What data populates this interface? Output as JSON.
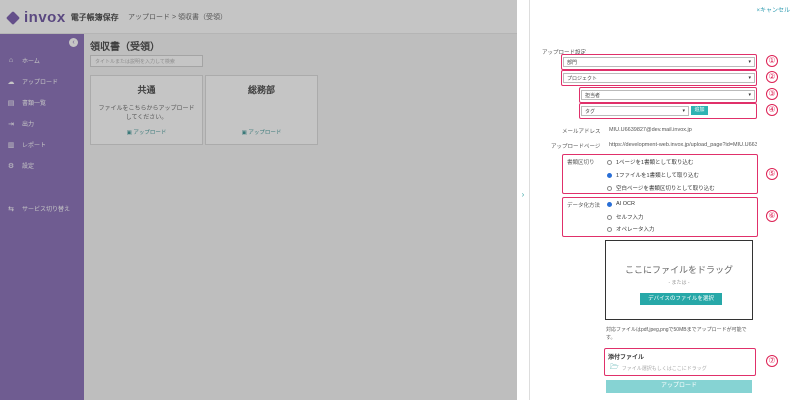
{
  "app": {
    "logo_word": "invox",
    "logo_sub": "電子帳簿保存",
    "breadcrumb": "アップロード > 領収書（受領）"
  },
  "sidebar": {
    "items": [
      {
        "icon": "⌂",
        "label": "ホーム"
      },
      {
        "icon": "☁",
        "label": "アップロード"
      },
      {
        "icon": "▤",
        "label": "書類一覧"
      },
      {
        "icon": "⇥",
        "label": "出力"
      },
      {
        "icon": "▥",
        "label": "レポート"
      },
      {
        "icon": "⚙",
        "label": "設定"
      },
      {
        "icon": "⇆",
        "label": "サービス切り替え"
      }
    ]
  },
  "main": {
    "title": "領収書（受領）",
    "search_placeholder": "タイトルまたは説明を入力して検索",
    "cards": [
      {
        "title": "共通",
        "desc": "ファイルをこちらからアップロードしてください。",
        "upload": "アップロード"
      },
      {
        "title": "総務部",
        "desc": "",
        "upload": "アップロード"
      }
    ]
  },
  "panel": {
    "cancel": "×キャンセル",
    "upload_dest_label": "アップロード設定",
    "department": "部門",
    "project": "プロジェクト",
    "assignee": "担当者",
    "tag": "タグ",
    "add": "追加",
    "email_label": "メールアドレス",
    "email_value": "MIU.U6639827@dev.mail.invox.jp",
    "page_label": "アップロードページ",
    "page_value": "https://development-web.invox.jp/upload_page?id=MIU.U663",
    "split_label": "書類区切り",
    "split_options": [
      "1ページを1書類として取り込む",
      "1ファイルを1書類として取り込む",
      "空白ページを書類区切りとして取り込む"
    ],
    "split_selected": 1,
    "data_label": "データ化方法",
    "data_options": [
      "AI OCR",
      "セルフ入力",
      "オペレータ入力"
    ],
    "data_selected": 0,
    "drop_title": "ここにファイルをドラッグ",
    "drop_or": "- または -",
    "drop_button": "デバイスのファイルを選択",
    "note": "対応ファイルはpdf,jpeg,pngで50MBまでアップロードが可能です。",
    "attach_title": "添付ファイル",
    "attach_placeholder": "ファイル選択もしくはここにドラッグ",
    "upload_button": "アップロード",
    "markers": [
      "①",
      "②",
      "③",
      "④",
      "⑤",
      "⑥",
      "⑦"
    ]
  },
  "colors": {
    "sidebar": "#7b5fb0",
    "accent": "#27a8a8",
    "highlight": "#e0306a"
  }
}
